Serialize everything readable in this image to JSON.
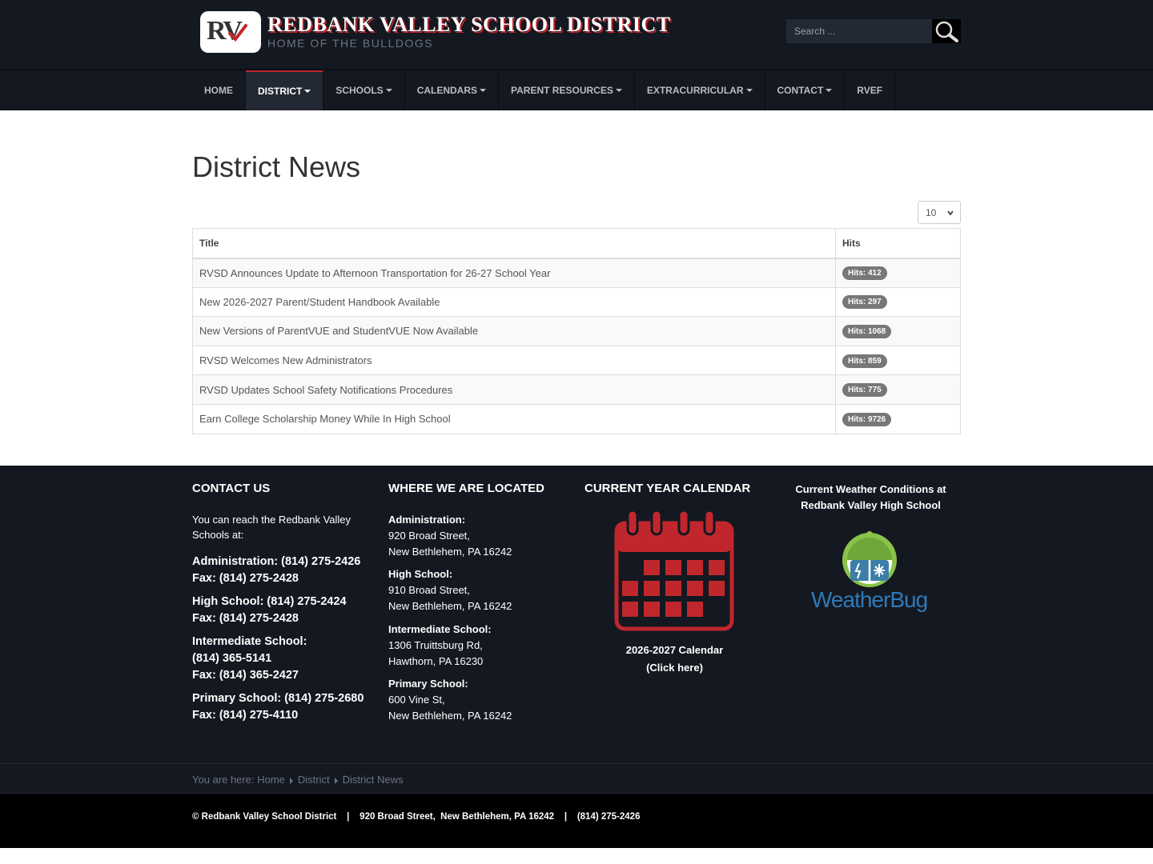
{
  "header": {
    "logo_text": "RV",
    "site_title": "REDBANK VALLEY SCHOOL DISTRICT",
    "tagline": "HOME OF THE BULLDOGS",
    "search_placeholder": "Search ..."
  },
  "nav": {
    "items": [
      {
        "label": "HOME",
        "dropdown": false
      },
      {
        "label": "DISTRICT",
        "dropdown": true,
        "active": true
      },
      {
        "label": "SCHOOLS",
        "dropdown": true
      },
      {
        "label": "CALENDARS",
        "dropdown": true
      },
      {
        "label": "PARENT RESOURCES",
        "dropdown": true
      },
      {
        "label": "EXTRACURRICULAR",
        "dropdown": true
      },
      {
        "label": "CONTACT",
        "dropdown": true
      },
      {
        "label": "RVEF",
        "dropdown": false
      }
    ]
  },
  "main": {
    "title": "District News",
    "limit_value": "10",
    "table": {
      "headers": [
        "Title",
        "Hits"
      ],
      "rows": [
        {
          "title": "RVSD Announces Update to Afternoon Transportation for 26-27 School Year",
          "hits": "Hits: 412"
        },
        {
          "title": "New 2026-2027 Parent/Student Handbook Available",
          "hits": "Hits: 297"
        },
        {
          "title": "New Versions of ParentVUE and StudentVUE Now Available",
          "hits": "Hits: 1068"
        },
        {
          "title": "RVSD Welcomes New Administrators",
          "hits": "Hits: 859"
        },
        {
          "title": "RVSD Updates School Safety Notifications Procedures",
          "hits": "Hits: 775"
        },
        {
          "title": "Earn College Scholarship Money While In High School",
          "hits": "Hits: 9726"
        }
      ]
    }
  },
  "footer": {
    "contact": {
      "heading": "CONTACT US",
      "intro": "You can reach the Redbank Valley Schools at:",
      "blocks": [
        [
          "Administration: (814) 275-2426",
          "Fax: (814) 275-2428"
        ],
        [
          "High School: (814) 275-2424",
          "Fax: (814) 275-2428"
        ],
        [
          "Intermediate School:",
          "(814) 365-5141",
          "Fax: (814) 365-2427"
        ],
        [
          "Primary School: (814) 275-2680",
          "Fax: (814) 275-4110"
        ]
      ]
    },
    "locations": {
      "heading": "WHERE WE ARE LOCATED",
      "items": [
        {
          "name": "Administration:",
          "street": "920 Broad Street,",
          "city": "New Bethlehem, PA 16242"
        },
        {
          "name": "High School:",
          "street": "910 Broad Street,",
          "city": "New Bethlehem, PA 16242"
        },
        {
          "name": "Intermediate School:",
          "street": "1306 Truittsburg Rd,",
          "city": "Hawthorn, PA 16230"
        },
        {
          "name": "Primary School:",
          "street": "600 Vine St,",
          "city": "New Bethlehem, PA 16242"
        }
      ]
    },
    "calendar": {
      "heading": "CURRENT YEAR CALENDAR",
      "caption_line1": "2026-2027 Calendar",
      "caption_line2": "(Click here)",
      "icon": "calendar-icon",
      "color": "#c0272d"
    },
    "weather": {
      "title": "Current Weather Conditions at Redbank Valley High School",
      "brand": "WeatherBug",
      "brand_color": "#2f7ab8"
    },
    "breadcrumb": {
      "prefix": "You are here:",
      "items": [
        "Home",
        "District",
        "District News"
      ]
    },
    "copyright": "© Redbank Valley School District    |    920 Broad Street,  New Bethlehem, PA 16242    |    (814) 275-2426"
  },
  "colors": {
    "header_bg": "#141820",
    "accent": "#c0272d",
    "badge": "#777777"
  }
}
